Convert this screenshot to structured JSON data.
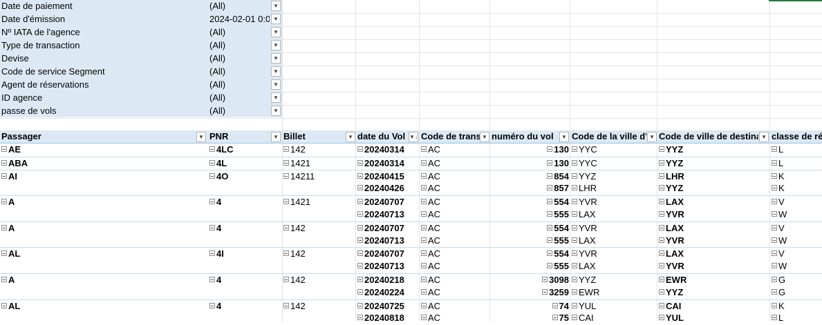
{
  "filters": [
    {
      "label": "Date de paiement",
      "value": "(All)"
    },
    {
      "label": "Date d'émission",
      "value": "2024-02-01 0:0"
    },
    {
      "label": "Nº IATA de l'agence",
      "value": "(All)"
    },
    {
      "label": "Type de transaction",
      "value": "(All)"
    },
    {
      "label": "Devise",
      "value": "(All)"
    },
    {
      "label": "Code de service Segment",
      "value": "(All)"
    },
    {
      "label": "Agent de réservations",
      "value": "(All)"
    },
    {
      "label": "ID agence",
      "value": "(All)"
    },
    {
      "label": "passe de vols",
      "value": "(All)"
    }
  ],
  "columns": [
    "Passager",
    "PNR",
    "Billet",
    "date du Vol",
    "Code de trans",
    "numéro du vol",
    "Code de la ville d'o",
    "Code de ville de destinat",
    "classe de rés"
  ],
  "rows": [
    {
      "passenger": "AE",
      "pnr": "4LC",
      "ticket": "142",
      "date": "20240314",
      "trans": "AC",
      "flight": "130",
      "orig": "YYC",
      "dest": "YYZ",
      "cls": "L",
      "first": true
    },
    {
      "passenger": "ABA",
      "pnr": "4L",
      "ticket": "1421",
      "date": "20240314",
      "trans": "AC",
      "flight": "130",
      "orig": "YYC",
      "dest": "YYZ",
      "cls": "L",
      "first": true
    },
    {
      "passenger": "AI",
      "pnr": "4O",
      "ticket": "14211",
      "date": "20240415",
      "trans": "AC",
      "flight": "854",
      "orig": "YYZ",
      "dest": "LHR",
      "cls": "K",
      "first": true
    },
    {
      "passenger": "",
      "pnr": "",
      "ticket": "",
      "date": "20240426",
      "trans": "AC",
      "flight": "857",
      "orig": "LHR",
      "dest": "YYZ",
      "cls": "K",
      "first": false
    },
    {
      "passenger": "A",
      "pnr": "4",
      "ticket": "1421",
      "date": "20240707",
      "trans": "AC",
      "flight": "554",
      "orig": "YVR",
      "dest": "LAX",
      "cls": "V",
      "first": true
    },
    {
      "passenger": "",
      "pnr": "",
      "ticket": "",
      "date": "20240713",
      "trans": "AC",
      "flight": "555",
      "orig": "LAX",
      "dest": "YVR",
      "cls": "W",
      "first": false
    },
    {
      "passenger": "A",
      "pnr": "4",
      "ticket": "142",
      "date": "20240707",
      "trans": "AC",
      "flight": "554",
      "orig": "YVR",
      "dest": "LAX",
      "cls": "V",
      "first": true
    },
    {
      "passenger": "",
      "pnr": "",
      "ticket": "",
      "date": "20240713",
      "trans": "AC",
      "flight": "555",
      "orig": "LAX",
      "dest": "YVR",
      "cls": "W",
      "first": false
    },
    {
      "passenger": "AL",
      "pnr": "4I",
      "ticket": "142",
      "date": "20240707",
      "trans": "AC",
      "flight": "554",
      "orig": "YVR",
      "dest": "LAX",
      "cls": "V",
      "first": true
    },
    {
      "passenger": "",
      "pnr": "",
      "ticket": "",
      "date": "20240713",
      "trans": "AC",
      "flight": "555",
      "orig": "LAX",
      "dest": "YVR",
      "cls": "W",
      "first": false
    },
    {
      "passenger": "A",
      "pnr": "4",
      "ticket": "142",
      "date": "20240218",
      "trans": "AC",
      "flight": "3098",
      "orig": "YYZ",
      "dest": "EWR",
      "cls": "G",
      "first": true
    },
    {
      "passenger": "",
      "pnr": "",
      "ticket": "",
      "date": "20240224",
      "trans": "AC",
      "flight": "3259",
      "orig": "EWR",
      "dest": "YYZ",
      "cls": "G",
      "first": false
    },
    {
      "passenger": "AL",
      "pnr": "4",
      "ticket": "142",
      "date": "20240725",
      "trans": "AC",
      "flight": "74",
      "orig": "YUL",
      "dest": "CAI",
      "cls": "K",
      "first": true
    },
    {
      "passenger": "",
      "pnr": "",
      "ticket": "",
      "date": "20240818",
      "trans": "AC",
      "flight": "75",
      "orig": "CAI",
      "dest": "YUL",
      "cls": "L",
      "first": false
    }
  ]
}
